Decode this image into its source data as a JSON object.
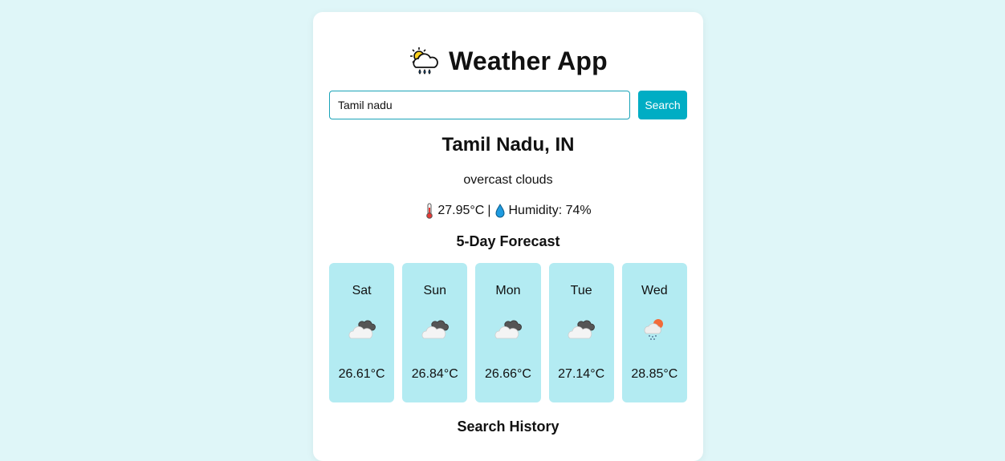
{
  "app": {
    "title": "Weather App",
    "logo_icon": "sun-behind-rain-cloud-icon"
  },
  "search": {
    "value": "Tamil nadu",
    "button_label": "Search"
  },
  "current": {
    "location": "Tamil Nadu, IN",
    "description": "overcast clouds",
    "temperature": "27.95°C",
    "separator": "|",
    "humidity": "Humidity: 74%"
  },
  "forecast": {
    "title": "5-Day Forecast",
    "days": [
      {
        "day": "Sat",
        "icon": "broken-clouds-icon",
        "temp": "26.61°C"
      },
      {
        "day": "Sun",
        "icon": "broken-clouds-icon",
        "temp": "26.84°C"
      },
      {
        "day": "Mon",
        "icon": "broken-clouds-icon",
        "temp": "26.66°C"
      },
      {
        "day": "Tue",
        "icon": "broken-clouds-icon",
        "temp": "27.14°C"
      },
      {
        "day": "Wed",
        "icon": "light-rain-icon",
        "temp": "28.85°C"
      }
    ]
  },
  "history": {
    "title": "Search History"
  },
  "colors": {
    "page_bg": "#dff6f8",
    "accent": "#00adc4",
    "day_card_bg": "#b3ebf2"
  }
}
